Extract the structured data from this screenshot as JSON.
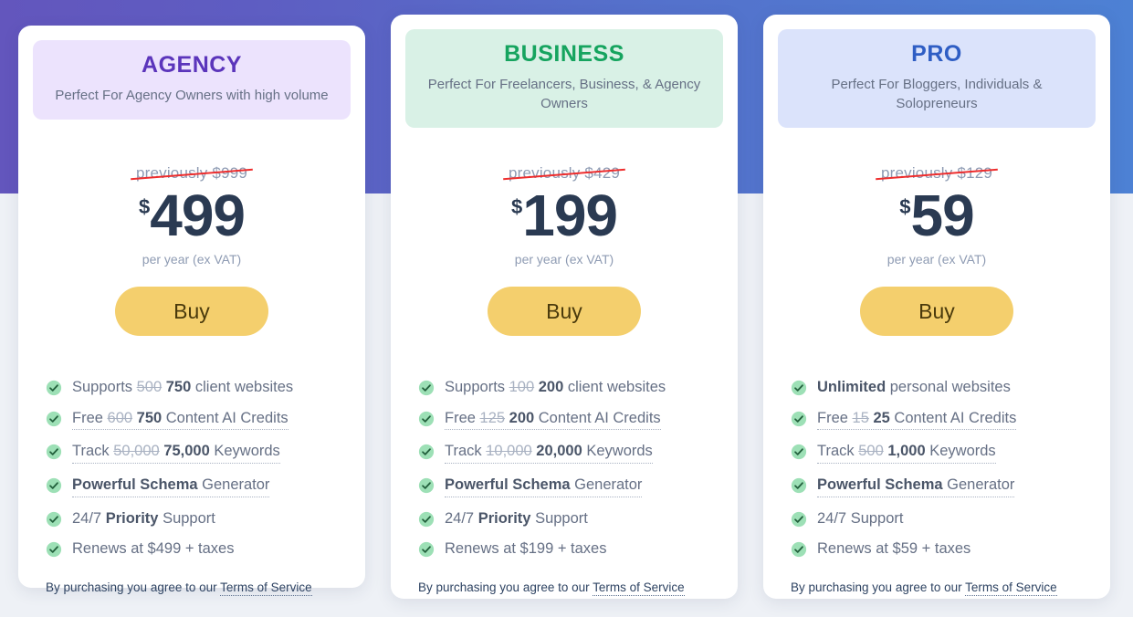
{
  "background": {
    "gradient_from": "#6356bd",
    "gradient_to": "#4d81d4",
    "page_color": "#eef1f6"
  },
  "common": {
    "currency_symbol": "$",
    "period_label": "per year (ex VAT)",
    "buy_label": "Buy",
    "terms_prefix": "By purchasing you agree to our ",
    "terms_link": "Terms of Service",
    "check_icon": "check-circle-icon"
  },
  "plans": [
    {
      "id": "agency",
      "name": "AGENCY",
      "tagline": "Perfect For Agency Owners with high volume",
      "name_color": "#5b35bb",
      "header_bg": "#ece3fd",
      "previously": "previously $999",
      "currency": "$",
      "amount": "499",
      "period": "per year (ex VAT)",
      "buy_label": "Buy",
      "features": [
        {
          "prefix": "Supports ",
          "old": "500",
          "new": "750",
          "suffix": " client websites",
          "dotted": false
        },
        {
          "prefix": "Free ",
          "old": "600",
          "new": "750",
          "suffix": " Content AI Credits",
          "dotted": true
        },
        {
          "prefix": "Track ",
          "old": "50,000",
          "new": "75,000",
          "suffix": " Keywords",
          "dotted": true
        },
        {
          "prefix": "",
          "old": "",
          "new": "Powerful Schema",
          "suffix": " Generator",
          "dotted": true
        },
        {
          "prefix": "24/7 ",
          "old": "",
          "new": "Priority",
          "suffix": " Support",
          "dotted": false
        },
        {
          "prefix": "Renews at $499 + taxes",
          "old": "",
          "new": "",
          "suffix": "",
          "dotted": false
        }
      ],
      "terms_prefix": "By purchasing you agree to our ",
      "terms_link": "Terms of Service"
    },
    {
      "id": "business",
      "name": "BUSINESS",
      "tagline": "Perfect For Freelancers, Business, & Agency Owners",
      "name_color": "#16a45f",
      "header_bg": "#d9f1e6",
      "previously": "previously $429",
      "currency": "$",
      "amount": "199",
      "period": "per year (ex VAT)",
      "buy_label": "Buy",
      "features": [
        {
          "prefix": "Supports ",
          "old": "100",
          "new": "200",
          "suffix": " client websites",
          "dotted": false
        },
        {
          "prefix": "Free ",
          "old": "125",
          "new": "200",
          "suffix": " Content AI Credits",
          "dotted": true
        },
        {
          "prefix": "Track ",
          "old": "10,000",
          "new": "20,000",
          "suffix": " Keywords",
          "dotted": true
        },
        {
          "prefix": "",
          "old": "",
          "new": "Powerful Schema",
          "suffix": " Generator",
          "dotted": true
        },
        {
          "prefix": "24/7 ",
          "old": "",
          "new": "Priority",
          "suffix": " Support",
          "dotted": false
        },
        {
          "prefix": "Renews at $199 + taxes",
          "old": "",
          "new": "",
          "suffix": "",
          "dotted": false
        }
      ],
      "terms_prefix": "By purchasing you agree to our ",
      "terms_link": "Terms of Service"
    },
    {
      "id": "pro",
      "name": "PRO",
      "tagline": "Perfect For Bloggers, Individuals & Solopreneurs",
      "name_color": "#2f5ec4",
      "header_bg": "#dbe3fb",
      "previously": "previously $129",
      "currency": "$",
      "amount": "59",
      "period": "per year (ex VAT)",
      "buy_label": "Buy",
      "features": [
        {
          "prefix": "",
          "old": "",
          "new": "Unlimited",
          "suffix": " personal websites",
          "dotted": false
        },
        {
          "prefix": "Free ",
          "old": "15",
          "new": "25",
          "suffix": " Content AI Credits",
          "dotted": true
        },
        {
          "prefix": "Track ",
          "old": "500",
          "new": "1,000",
          "suffix": " Keywords",
          "dotted": true
        },
        {
          "prefix": "",
          "old": "",
          "new": "Powerful Schema",
          "suffix": " Generator",
          "dotted": true
        },
        {
          "prefix": "24/7 Support",
          "old": "",
          "new": "",
          "suffix": "",
          "dotted": false
        },
        {
          "prefix": "Renews at $59 + taxes",
          "old": "",
          "new": "",
          "suffix": "",
          "dotted": false
        }
      ],
      "terms_prefix": "By purchasing you agree to our ",
      "terms_link": "Terms of Service"
    }
  ]
}
